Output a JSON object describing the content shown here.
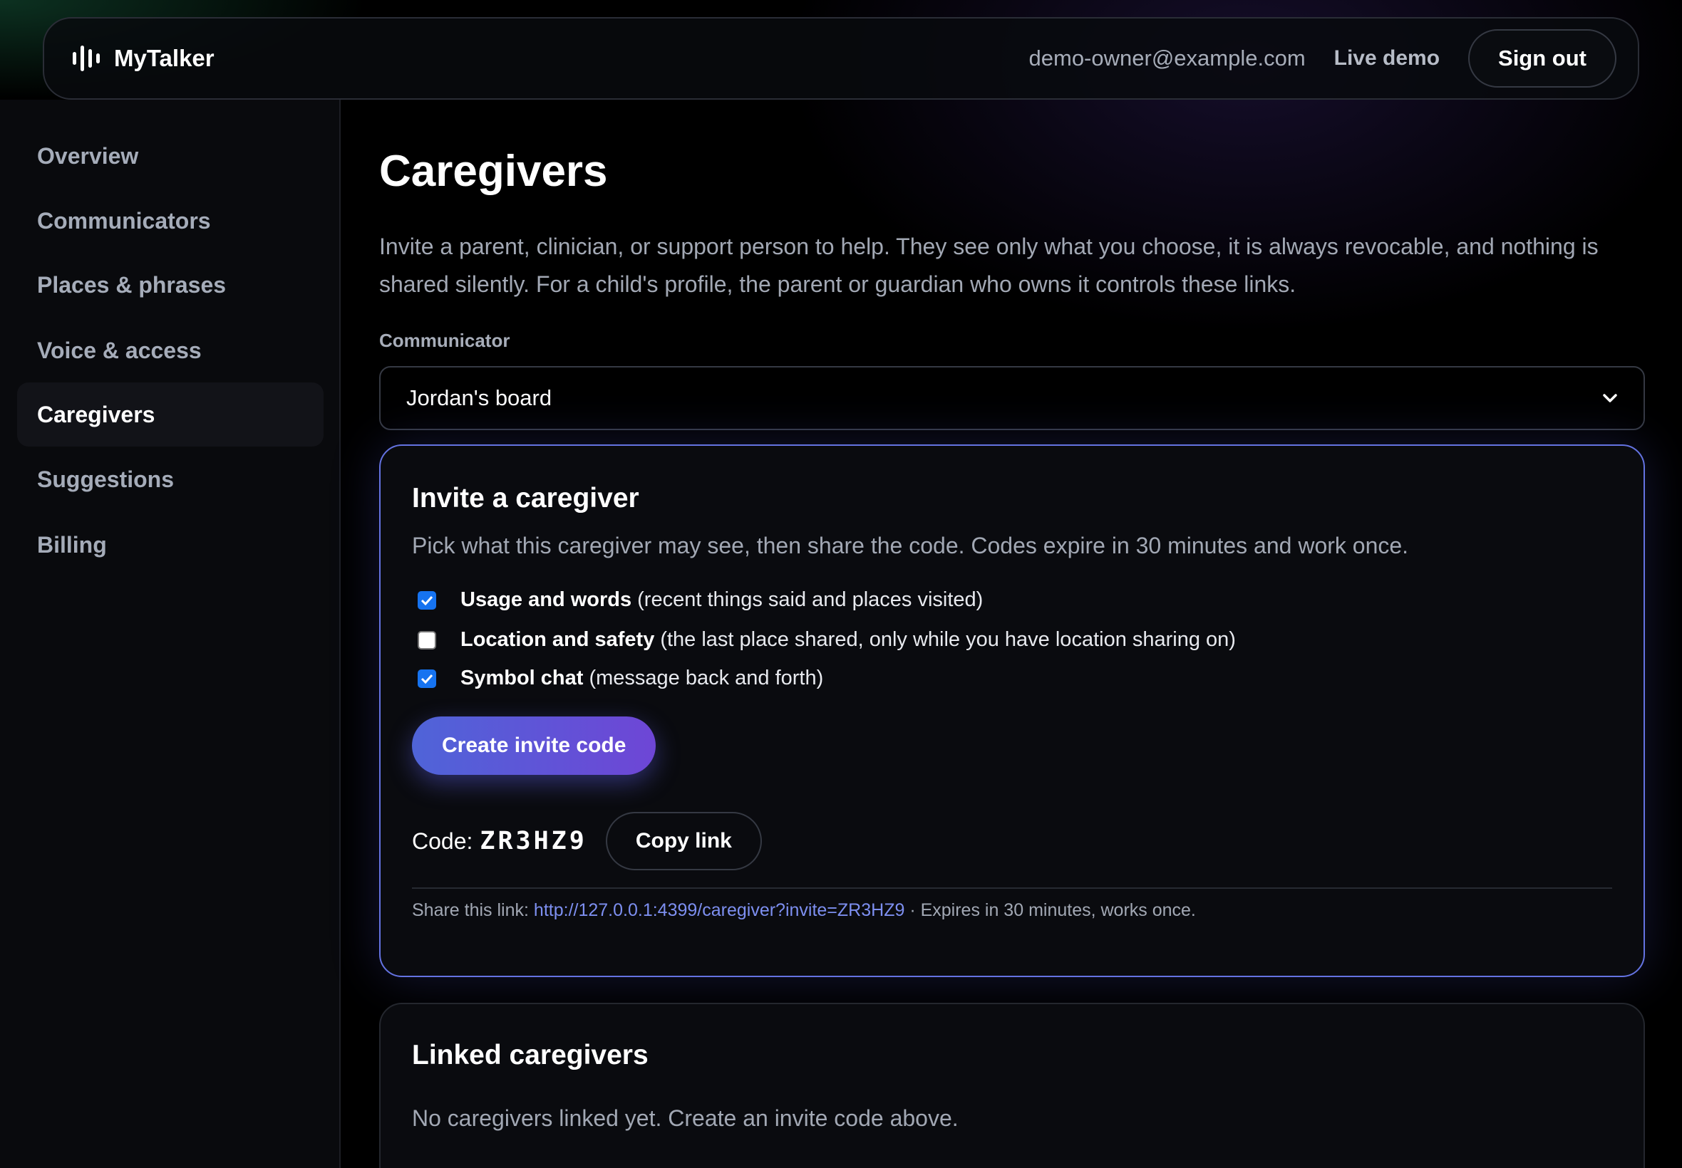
{
  "header": {
    "brand": "MyTalker",
    "user_email": "demo-owner@example.com",
    "live_demo": "Live demo",
    "sign_out": "Sign out"
  },
  "sidebar": {
    "items": [
      {
        "label": "Overview",
        "active": false
      },
      {
        "label": "Communicators",
        "active": false
      },
      {
        "label": "Places & phrases",
        "active": false
      },
      {
        "label": "Voice & access",
        "active": false
      },
      {
        "label": "Caregivers",
        "active": true
      },
      {
        "label": "Suggestions",
        "active": false
      },
      {
        "label": "Billing",
        "active": false
      }
    ]
  },
  "main": {
    "title": "Caregivers",
    "description": "Invite a parent, clinician, or support person to help. They see only what you choose, it is always revocable, and nothing is shared silently. For a child's profile, the parent or guardian who owns it controls these links.",
    "communicator_label": "Communicator",
    "communicator_value": "Jordan's board"
  },
  "invite": {
    "title": "Invite a caregiver",
    "description": "Pick what this caregiver may see, then share the code. Codes expire in 30 minutes and work once.",
    "permissions": [
      {
        "label": "Usage and words",
        "detail": "(recent things said and places visited)",
        "checked": true
      },
      {
        "label": "Location and safety",
        "detail": "(the last place shared, only while you have location sharing on)",
        "checked": false
      },
      {
        "label": "Symbol chat",
        "detail": "(message back and forth)",
        "checked": true
      }
    ],
    "create_button": "Create invite code",
    "code_label": "Code:",
    "code_value": "ZR3HZ9",
    "copy_button": "Copy link",
    "share_prefix": "Share this link:",
    "share_link": "http://127.0.0.1:4399/caregiver?invite=ZR3HZ9",
    "share_suffix": "· Expires in 30 minutes, works once."
  },
  "linked": {
    "title": "Linked caregivers",
    "empty_text": "No caregivers linked yet. Create an invite code above."
  },
  "colors": {
    "accent_border": "#6473e2",
    "button_gradient_start": "#4f64d8",
    "button_gradient_end": "#6e46d6",
    "link": "#7d8ff0",
    "checkbox": "#1673f0"
  }
}
